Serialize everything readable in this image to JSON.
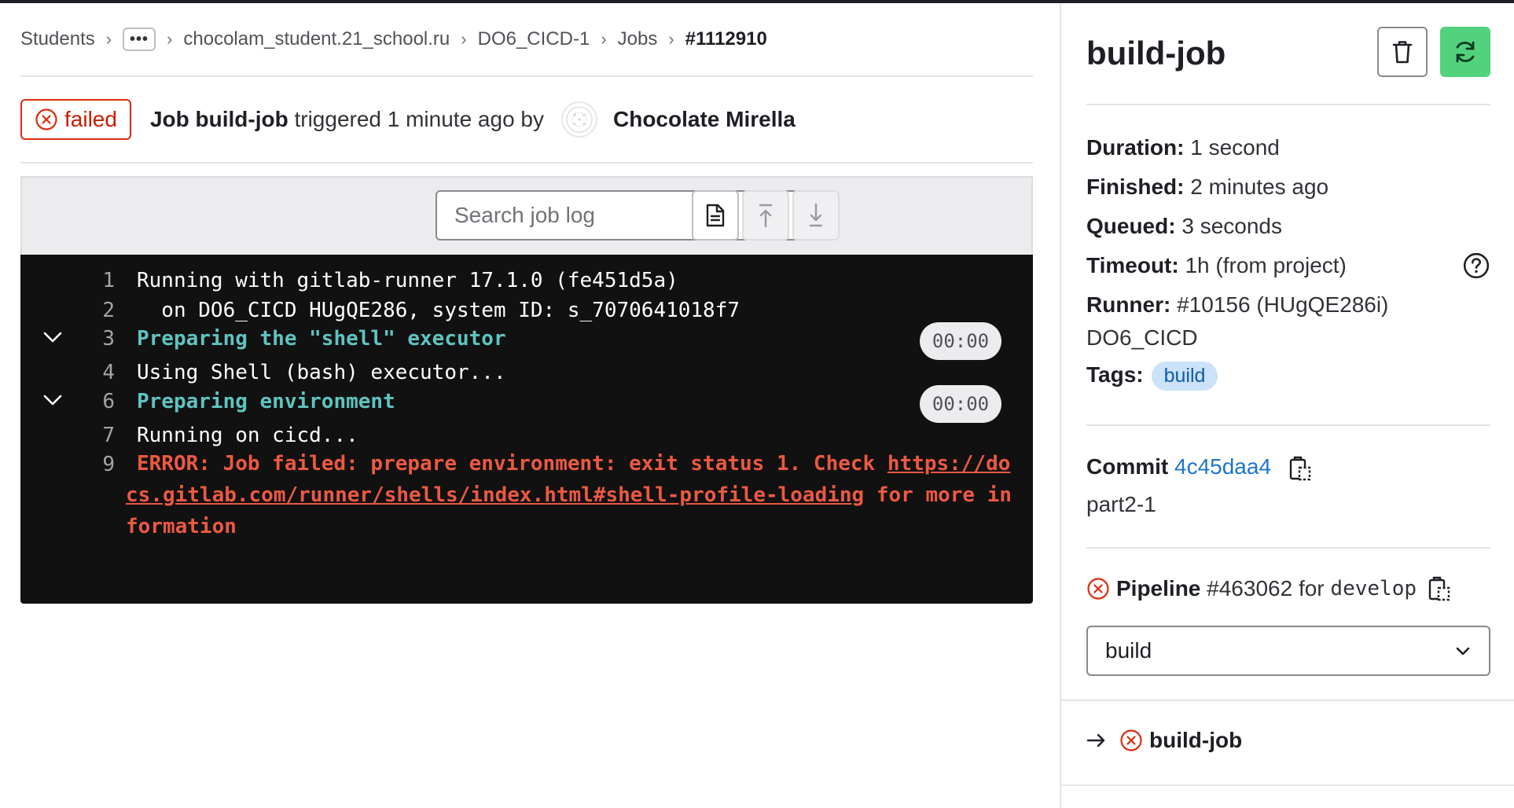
{
  "breadcrumb": {
    "items": [
      "Students",
      "chocolam_student.21_school.ru",
      "DO6_CICD-1",
      "Jobs"
    ],
    "ellipsis": "•••",
    "current": "#1112910",
    "separator": "›"
  },
  "job_header": {
    "status": "failed",
    "prefix": "Job",
    "job_name": "build-job",
    "triggered_text": "triggered 1 minute ago by",
    "user": "Chocolate Mirella"
  },
  "toolbar": {
    "search_placeholder": "Search job log"
  },
  "log": {
    "lines": [
      {
        "num": "1",
        "text": "Running with gitlab-runner 17.1.0 (fe451d5a)"
      },
      {
        "num": "2",
        "text": "  on DO6_CICD HUgQE286, system ID: s_7070641018f7"
      },
      {
        "num": "3",
        "text": "Preparing the \"shell\" executor",
        "duration": "00:00"
      },
      {
        "num": "4",
        "text": "Using Shell (bash) executor..."
      },
      {
        "num": "6",
        "text": "Preparing environment",
        "duration": "00:00"
      },
      {
        "num": "7",
        "text": "Running on cicd..."
      },
      {
        "num": "9",
        "error_prefix": "ERROR: Job failed: prepare environment: exit status 1. Check",
        "error_link": "https://docs.gitlab.com/runner/shells/index.html#shell-profile-loading",
        "error_suffix": "for more information"
      }
    ]
  },
  "sidebar": {
    "title": "build-job",
    "duration_label": "Duration:",
    "duration": "1 second",
    "finished_label": "Finished:",
    "finished": "2 minutes ago",
    "queued_label": "Queued:",
    "queued": "3 seconds",
    "timeout_label": "Timeout:",
    "timeout": "1h (from project)",
    "runner_label": "Runner:",
    "runner": "#10156 (HUgQE286i)",
    "runner_name": "DO6_CICD",
    "tags_label": "Tags:",
    "tag": "build",
    "commit_label": "Commit",
    "commit_sha": "4c45daa4",
    "commit_message": "part2-1",
    "pipeline_label": "Pipeline",
    "pipeline_id": "#463062",
    "pipeline_for": "for",
    "pipeline_ref": "develop",
    "stage_select": "build",
    "job_link": "build-job"
  },
  "colors": {
    "failed": "#dd2b0e",
    "retry_button": "#52d27c",
    "log_bg": "#111111",
    "section_text": "#5ec4c0",
    "error_text": "#ec5941",
    "link": "#1f75cb",
    "tag_bg": "#cbe2f9"
  },
  "icons": [
    "x-circle-icon",
    "search-icon",
    "question-icon",
    "raw-log-icon",
    "scroll-top-icon",
    "scroll-bottom-icon",
    "chevron-down-icon",
    "trash-icon",
    "retry-icon",
    "copy-icon",
    "arrow-right-icon"
  ]
}
